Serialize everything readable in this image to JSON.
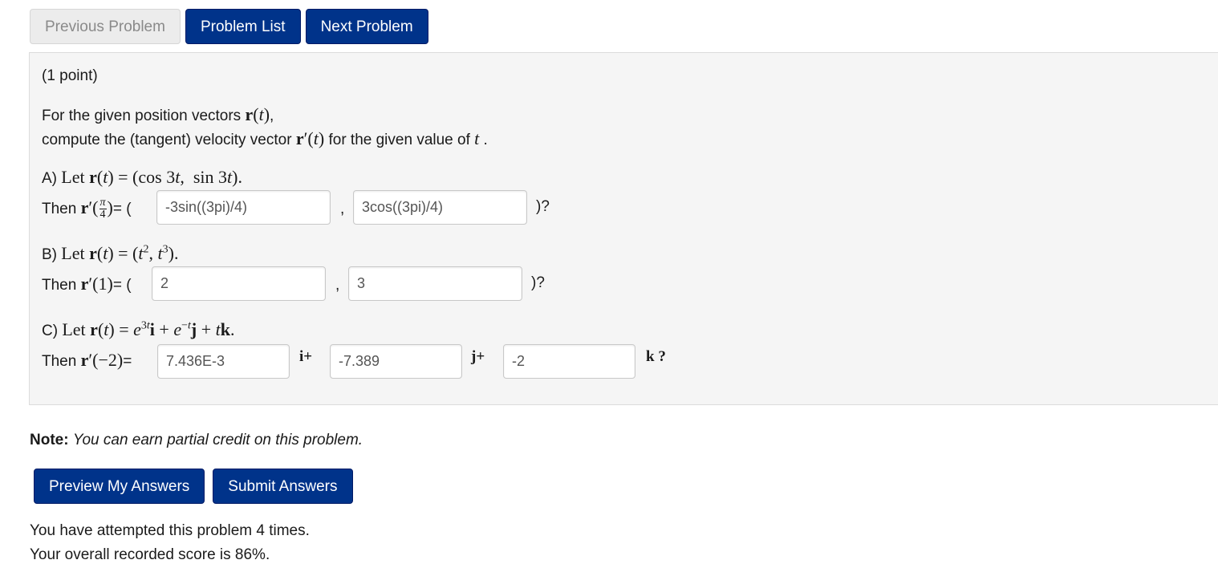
{
  "nav": {
    "previous": "Previous Problem",
    "list": "Problem List",
    "next": "Next Problem"
  },
  "problem": {
    "points": "(1 point)",
    "intro_1": "For the given position vectors",
    "intro_1_tail": ",",
    "intro_2": "compute the (tangent) velocity vector",
    "intro_2_tail": "for the given value of",
    "intro_2_end": ".",
    "part_a": {
      "label": "A)",
      "let_text": "Let r(t) = (cos 3t, sin 3t).",
      "then": "Then",
      "open": "= (",
      "sep": ",",
      "close": ")?",
      "answers": [
        "-3sin((3pi)/4)",
        "3cos((3pi)/4)"
      ]
    },
    "part_b": {
      "label": "B)",
      "then": "Then",
      "open": "= (",
      "sep": ",",
      "close": ")?",
      "answers": [
        "2",
        "3"
      ]
    },
    "part_c": {
      "label": "C)",
      "then": "Then",
      "open": "=",
      "i_sep": "i+",
      "j_sep": "j+",
      "k_end": "k ?",
      "answers": [
        "7.436E-3",
        "-7.389",
        "-2"
      ]
    }
  },
  "note": {
    "label": "Note:",
    "text": "You can earn partial credit on this problem."
  },
  "actions": {
    "preview": "Preview My Answers",
    "submit": "Submit Answers"
  },
  "status": {
    "attempts": "You have attempted this problem 4 times.",
    "score": "Your overall recorded score is 86%."
  }
}
